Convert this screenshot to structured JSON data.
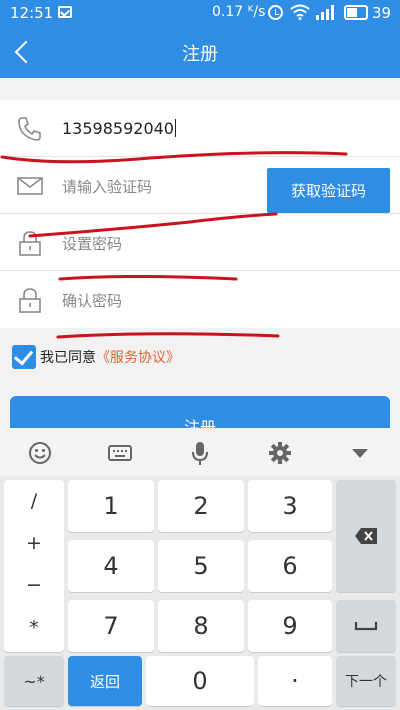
{
  "status_bar": {
    "time": "12:51",
    "network_speed": "0.17 ᴷ/s",
    "battery": "39"
  },
  "header": {
    "title": "注册"
  },
  "form": {
    "phone_value": "13598592040",
    "code_placeholder": "请输入验证码",
    "get_code_label": "获取验证码",
    "password_placeholder": "设置密码",
    "confirm_placeholder": "确认密码"
  },
  "agreement": {
    "checked": true,
    "text": "我已同意",
    "link": "《服务协议》"
  },
  "register_label": "注册",
  "keyboard": {
    "symbols": [
      "/",
      "+",
      "−",
      "*"
    ],
    "digits": [
      "1",
      "2",
      "3",
      "4",
      "5",
      "6",
      "7",
      "8",
      "9"
    ],
    "switch_key": "~*",
    "return_key": "返回",
    "zero_key": "0",
    "dot_key": "·",
    "next_key": "下一个"
  },
  "colors": {
    "primary": "#2f8de4",
    "link": "#e0653a",
    "scribble": "#c8141e"
  }
}
